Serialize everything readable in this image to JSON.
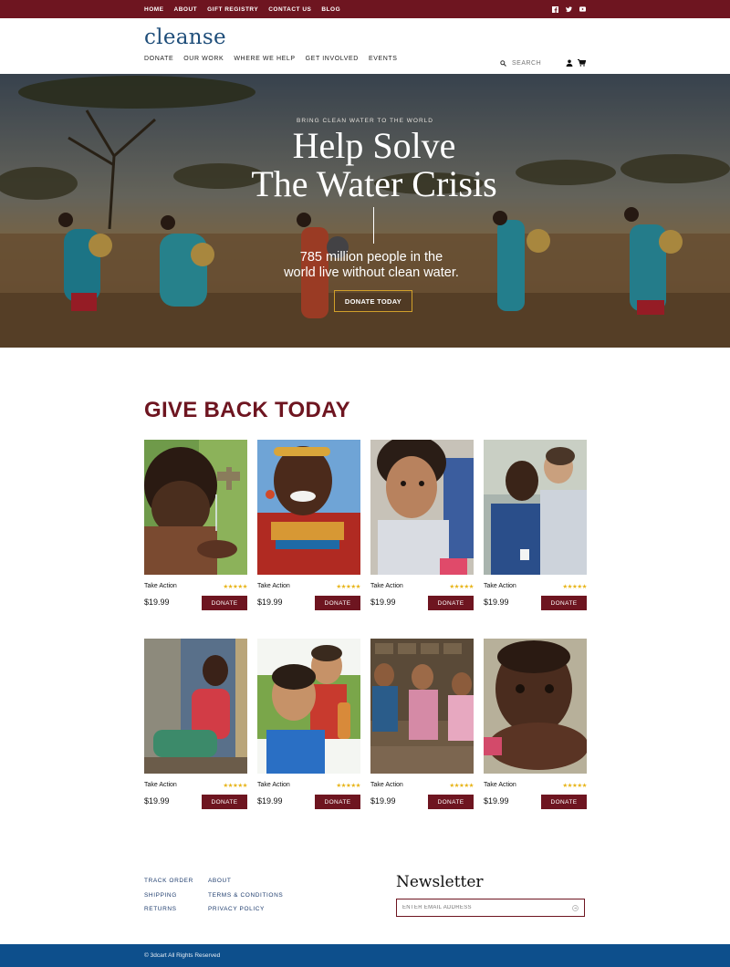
{
  "topbar": {
    "links": [
      "HOME",
      "ABOUT",
      "GIFT REGISTRY",
      "CONTACT US",
      "BLOG"
    ],
    "social": [
      "facebook-icon",
      "twitter-icon",
      "youtube-icon"
    ],
    "color": "#6e1520"
  },
  "header": {
    "logo": "cleanse",
    "nav": [
      "DONATE",
      "OUR WORK",
      "WHERE WE HELP",
      "GET INVOLVED",
      "EVENTS"
    ],
    "search_placeholder": "SEARCH",
    "icons": [
      "user-icon",
      "cart-icon"
    ]
  },
  "hero": {
    "kicker": "BRING CLEAN WATER TO THE WORLD",
    "title_line1": "Help Solve",
    "title_line2": "The Water Crisis",
    "subtitle_line1": "785 million people in the",
    "subtitle_line2": "world live without clean water.",
    "button": "DONATE TODAY"
  },
  "section": {
    "title": "GIVE BACK TODAY"
  },
  "products": [
    {
      "title": "Take Action",
      "price": "$19.99",
      "rating": 5,
      "button": "DONATE"
    },
    {
      "title": "Take Action",
      "price": "$19.99",
      "rating": 5,
      "button": "DONATE"
    },
    {
      "title": "Take Action",
      "price": "$19.99",
      "rating": 5,
      "button": "DONATE"
    },
    {
      "title": "Take Action",
      "price": "$19.99",
      "rating": 5,
      "button": "DONATE"
    },
    {
      "title": "Take Action",
      "price": "$19.99",
      "rating": 5,
      "button": "DONATE"
    },
    {
      "title": "Take Action",
      "price": "$19.99",
      "rating": 5,
      "button": "DONATE"
    },
    {
      "title": "Take Action",
      "price": "$19.99",
      "rating": 5,
      "button": "DONATE"
    },
    {
      "title": "Take Action",
      "price": "$19.99",
      "rating": 5,
      "button": "DONATE"
    }
  ],
  "footer": {
    "col1": [
      "TRACK ORDER",
      "SHIPPING",
      "RETURNS"
    ],
    "col2": [
      "ABOUT",
      "TERMS & CONDITIONS",
      "PRIVACY POLICY"
    ],
    "newsletter_title": "Newsletter",
    "email_placeholder": "ENTER EMAIL ADDRESS",
    "copyright": "© 3dcart All Rights Reserved",
    "bar_color": "#0d4f8c"
  }
}
